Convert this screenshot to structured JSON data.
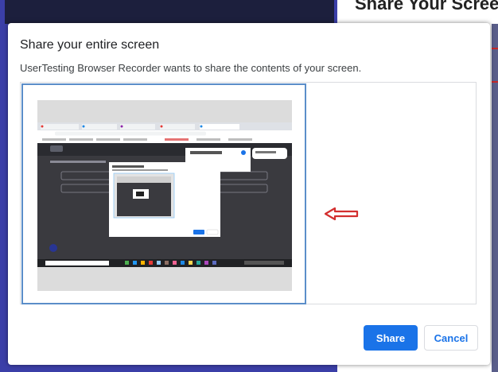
{
  "background": {
    "right_panel_title": "Share Your Screen"
  },
  "dialog": {
    "title": "Share your entire screen",
    "subtitle": "UserTesting Browser Recorder wants to share the contents of your screen.",
    "share_label": "Share",
    "cancel_label": "Cancel"
  },
  "colors": {
    "accent": "#1a73e8",
    "tile_border": "#5b8ec9",
    "arrow": "#d32f2f"
  },
  "icons": {
    "arrow": "left-arrow-icon"
  }
}
